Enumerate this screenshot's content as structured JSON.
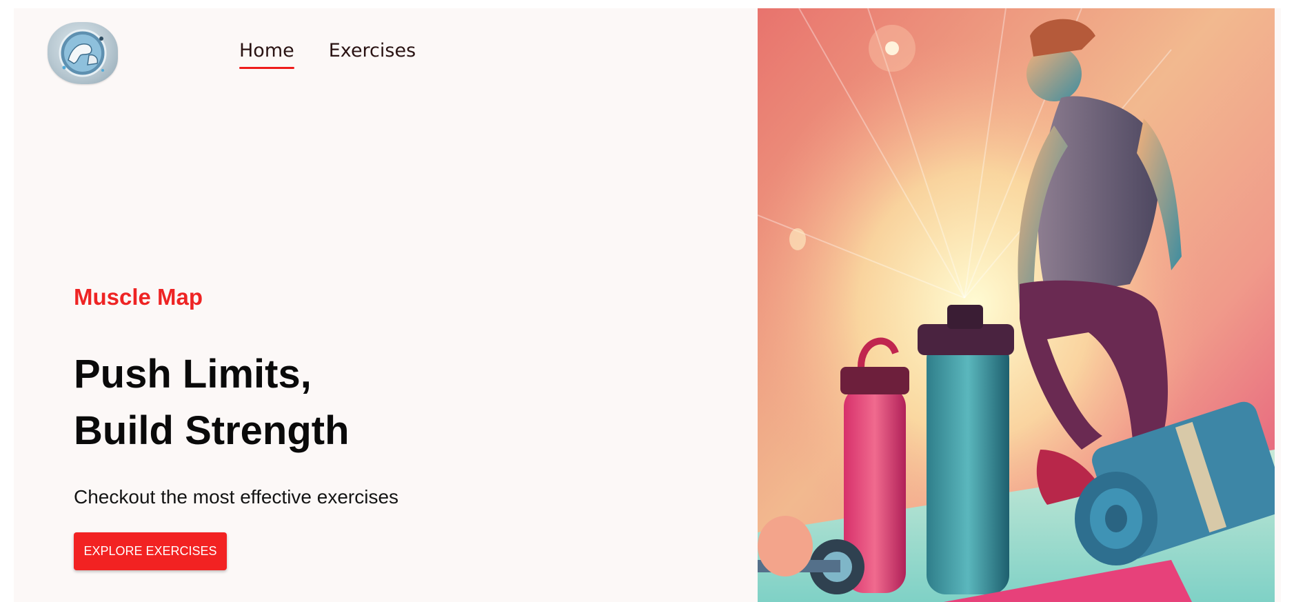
{
  "nav": {
    "items": [
      {
        "label": "Home",
        "active": true
      },
      {
        "label": "Exercises",
        "active": false
      }
    ]
  },
  "hero": {
    "brand": "Muscle Map",
    "headline_line1": "Push Limits,",
    "headline_line2": "Build Strength",
    "subtitle": "Checkout the most effective exercises",
    "cta_label": "EXPLORE EXERCISES"
  },
  "colors": {
    "accent": "#ee2424",
    "background": "#fcf8f7",
    "text": "#0a0a0a"
  },
  "icons": {
    "logo": "flexed-arm-logo-icon"
  }
}
